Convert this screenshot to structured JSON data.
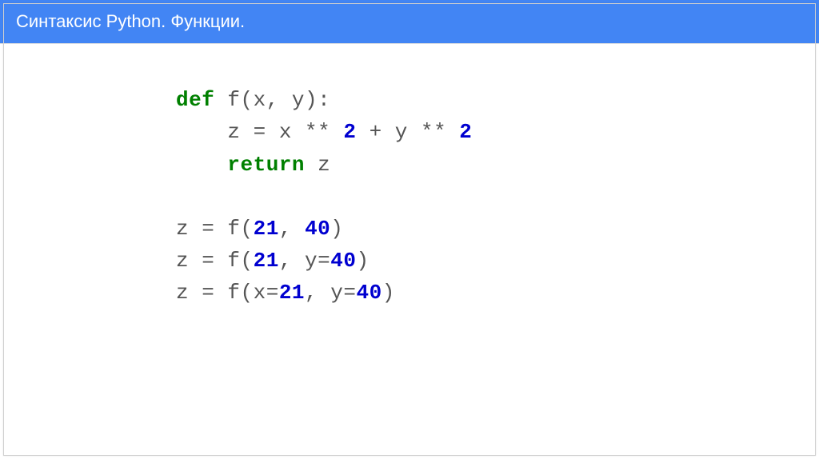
{
  "header": {
    "title": "Синтаксис Python. Функции."
  },
  "code": {
    "line1": {
      "def": "def",
      "rest": " f(x, y):"
    },
    "line2": {
      "indent": "    ",
      "pre": "z = x ** ",
      "num1": "2",
      "mid": " + y ** ",
      "num2": "2"
    },
    "line3": {
      "indent": "    ",
      "ret": "return",
      "rest": " z"
    },
    "line4": {
      "pre": "z = f(",
      "num1": "21",
      "sep": ", ",
      "num2": "40",
      "post": ")"
    },
    "line5": {
      "pre": "z = f(",
      "num1": "21",
      "sep": ", y=",
      "num2": "40",
      "post": ")"
    },
    "line6": {
      "pre": "z = f(x=",
      "num1": "21",
      "sep": ", y=",
      "num2": "40",
      "post": ")"
    }
  }
}
